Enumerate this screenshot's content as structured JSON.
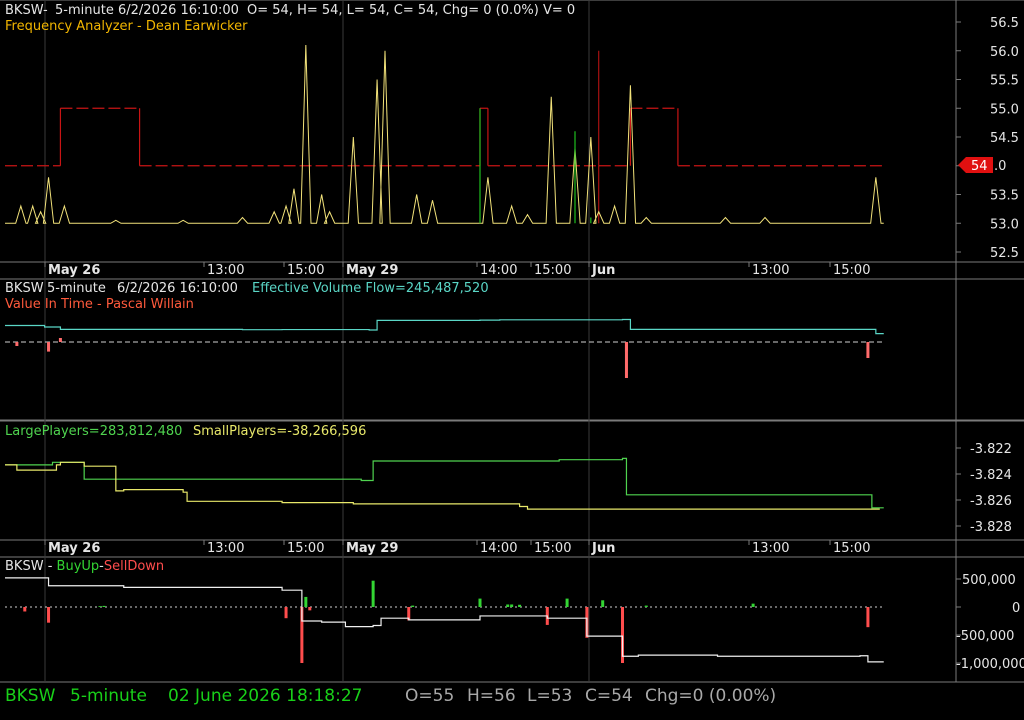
{
  "colors": {
    "background": "#000000",
    "grid": "#3a3a3a",
    "axis_text": "#e6e6e6",
    "price_line": "#f2e27a",
    "price_cross": "#1fbf1f",
    "level_dash": "#c81414",
    "evf_line": "#5ad6c6",
    "viw_bar": "#ff6b6b",
    "large_players": "#4fd34f",
    "small_players": "#e8e86a",
    "buy_up": "#33d633",
    "sell_down": "#ff4d4d",
    "white_line": "#f0f0f0",
    "status_green": "#19d019",
    "status_grey": "#a8a8a8",
    "price_tag": "#e01010"
  },
  "time_axis": {
    "labels": [
      "May 26",
      "13:00",
      "15:00",
      "May 29",
      "14:00",
      "15:00",
      "Jun",
      "13:00",
      "15:00"
    ],
    "bold": [
      "May 26",
      "May 29",
      "Jun"
    ]
  },
  "panels": {
    "price": {
      "header": {
        "symbol": "BKSW-",
        "interval": "5-minute",
        "datetime": "6/2/2026 16:10:00",
        "ohlc": "O= 54, H= 54, L= 54, C= 54, Chg= 0 (0.0%) V= 0"
      },
      "study": {
        "name": "Frequency Analyzer",
        "separator": " - ",
        "author": "Dean Earwicker"
      },
      "axis_ticks": [
        "56.5",
        "56.0",
        "55.5",
        "55.0",
        "54.5",
        "54.0",
        "53.5",
        "53.0",
        "52.5"
      ],
      "last_price_tag": "54"
    },
    "evf": {
      "header": {
        "symbol": "BKSW",
        "interval": "5-minute",
        "datetime": "6/2/2026 16:10:00",
        "study_label": "Effective Volume Flow=245,487,520"
      },
      "study": {
        "name": "Value In Time",
        "separator": " - ",
        "author": "Pascal Willain"
      }
    },
    "players": {
      "large_label": "LargePlayers=283,812,480",
      "small_label": "SmallPlayers=-38,266,596",
      "axis_ticks": [
        "-3.822",
        "-3.824",
        "-3.826",
        "-3.828"
      ]
    },
    "buysell": {
      "header": {
        "symbol": "BKSW",
        "sep1": " - ",
        "buy": "BuyUp",
        "sep2": "-",
        "sell": "SellDown"
      },
      "axis_ticks": [
        "500,000",
        "0",
        "-500,000",
        "-1,000,000"
      ]
    }
  },
  "status_bar": {
    "symbol": "BKSW",
    "interval": "5-minute",
    "datetime": "02 June 2026 18:18:27",
    "open": "O=55",
    "high": "H=56",
    "low": "L=53",
    "close": "C=54",
    "change": "Chg=0 (0.00%)"
  },
  "chart_data": [
    {
      "type": "line",
      "title": "Frequency Analyzer - Dean Earwicker",
      "ylim": [
        52.25,
        56.75
      ],
      "y_ticks": [
        52.5,
        53.0,
        53.5,
        54.0,
        54.5,
        55.0,
        55.5,
        56.0,
        56.5
      ],
      "x_range": [
        0,
        240
      ],
      "series": [
        {
          "name": "price_spikes",
          "baseline": 53.0,
          "spikes": [
            [
              4,
              53.3
            ],
            [
              7,
              53.3
            ],
            [
              9,
              53.2
            ],
            [
              11,
              53.8
            ],
            [
              15,
              53.3
            ],
            [
              28,
              53.05
            ],
            [
              45,
              53.05
            ],
            [
              60,
              53.1
            ],
            [
              68,
              53.2
            ],
            [
              71,
              53.3
            ],
            [
              73,
              53.6
            ],
            [
              76,
              56.1
            ],
            [
              80,
              53.5
            ],
            [
              82,
              53.2
            ],
            [
              88,
              54.5
            ],
            [
              94,
              55.5
            ],
            [
              96,
              56.0
            ],
            [
              104,
              53.5
            ],
            [
              108,
              53.4
            ],
            [
              122,
              53.8
            ],
            [
              128,
              53.3
            ],
            [
              132,
              53.15
            ],
            [
              138,
              55.2
            ],
            [
              144,
              54.3
            ],
            [
              148,
              54.5
            ],
            [
              150,
              53.2
            ],
            [
              154,
              53.3
            ],
            [
              158,
              55.4
            ],
            [
              162,
              53.1
            ],
            [
              182,
              53.1
            ],
            [
              192,
              53.1
            ],
            [
              220,
              53.8
            ]
          ]
        },
        {
          "name": "level_dashes",
          "segments": [
            [
              0,
              14,
              54.0
            ],
            [
              14,
              34,
              55.0
            ],
            [
              34,
              120,
              54.0
            ],
            [
              120,
              122,
              55.0
            ],
            [
              122,
              150,
              54.0
            ],
            [
              150,
              158,
              54.0
            ],
            [
              158,
              170,
              55.0
            ],
            [
              170,
              222,
              54.0
            ]
          ]
        },
        {
          "name": "green_crosses",
          "points": [
            [
              120,
              55.0
            ],
            [
              144,
              54.6
            ],
            [
              148,
              53.1
            ]
          ]
        }
      ]
    },
    {
      "type": "line",
      "title": "Effective Volume Flow",
      "series": [
        {
          "name": "Effective Volume Flow",
          "value": 245487520,
          "steps": [
            [
              0,
              0.55
            ],
            [
              10,
              0.5
            ],
            [
              14,
              0.42
            ],
            [
              40,
              0.42
            ],
            [
              60,
              0.41
            ],
            [
              70,
              0.415
            ],
            [
              92,
              0.4
            ],
            [
              94,
              0.72
            ],
            [
              120,
              0.73
            ],
            [
              125,
              0.74
            ],
            [
              156,
              0.75
            ],
            [
              158,
              0.42
            ],
            [
              216,
              0.42
            ],
            [
              220,
              0.28
            ],
            [
              222,
              0.28
            ]
          ]
        },
        {
          "name": "Value In Time",
          "bars": [
            [
              3,
              -0.05
            ],
            [
              11,
              -0.12
            ],
            [
              14,
              0.05
            ],
            [
              157,
              -0.45
            ],
            [
              157,
              -0.12
            ],
            [
              218,
              -0.2
            ]
          ]
        }
      ]
    },
    {
      "type": "line",
      "ylim": [
        -3.8292,
        -3.8208
      ],
      "y_ticks": [
        -3.822,
        -3.824,
        -3.826,
        -3.828
      ],
      "series": [
        {
          "name": "LargePlayers",
          "value": 283812480,
          "steps": [
            [
              0,
              -3.8233
            ],
            [
              12,
              -3.8231
            ],
            [
              20,
              -3.8244
            ],
            [
              60,
              -3.8244
            ],
            [
              90,
              -3.8245
            ],
            [
              93,
              -3.823
            ],
            [
              140,
              -3.8229
            ],
            [
              156,
              -3.8228
            ],
            [
              157,
              -3.8256
            ],
            [
              217,
              -3.8256
            ],
            [
              219,
              -3.8266
            ],
            [
              222,
              -3.8266
            ]
          ]
        },
        {
          "name": "SmallPlayers",
          "value": -38266596,
          "steps": [
            [
              0,
              -3.8233
            ],
            [
              3,
              -3.8237
            ],
            [
              11,
              -3.8237
            ],
            [
              13,
              -3.8233
            ],
            [
              14,
              -3.8231
            ],
            [
              20,
              -3.8234
            ],
            [
              28,
              -3.8253
            ],
            [
              30,
              -3.8252
            ],
            [
              38,
              -3.8252
            ],
            [
              45,
              -3.8254
            ],
            [
              46,
              -3.8261
            ],
            [
              70,
              -3.8262
            ],
            [
              86,
              -3.8262
            ],
            [
              88,
              -3.8263
            ],
            [
              130,
              -3.8265
            ],
            [
              132,
              -3.8267
            ],
            [
              180,
              -3.8267
            ],
            [
              221,
              -3.8267
            ]
          ]
        }
      ]
    },
    {
      "type": "bar",
      "ylim": [
        -1200000,
        700000
      ],
      "y_ticks": [
        500000,
        0,
        -500000,
        -1000000
      ],
      "series": [
        {
          "name": "BuyUp",
          "bars": [
            [
              24,
              15000
            ],
            [
              25,
              20000
            ],
            [
              76,
              180000
            ],
            [
              93,
              470000
            ],
            [
              103,
              25000
            ],
            [
              120,
              150000
            ],
            [
              127,
              45000
            ],
            [
              128,
              45000
            ],
            [
              130,
              40000
            ],
            [
              142,
              150000
            ],
            [
              151,
              120000
            ],
            [
              162,
              25000
            ],
            [
              189,
              60000
            ]
          ]
        },
        {
          "name": "SellDown",
          "bars": [
            [
              5,
              -80000
            ],
            [
              11,
              -280000
            ],
            [
              71,
              -200000
            ],
            [
              75,
              -1000000
            ],
            [
              77,
              -60000
            ],
            [
              102,
              -240000
            ],
            [
              137,
              -320000
            ],
            [
              147,
              -550000
            ],
            [
              156,
              -1000000
            ],
            [
              218,
              -360000
            ]
          ]
        },
        {
          "name": "cumulative_line",
          "steps": [
            [
              0,
              520000
            ],
            [
              11,
              380000
            ],
            [
              30,
              350000
            ],
            [
              70,
              300000
            ],
            [
              75,
              -250000
            ],
            [
              80,
              -270000
            ],
            [
              86,
              -350000
            ],
            [
              93,
              -330000
            ],
            [
              95,
              -200000
            ],
            [
              102,
              -230000
            ],
            [
              120,
              -160000
            ],
            [
              137,
              -200000
            ],
            [
              147,
              -520000
            ],
            [
              156,
              -880000
            ],
            [
              160,
              -860000
            ],
            [
              180,
              -880000
            ],
            [
              216,
              -870000
            ],
            [
              218,
              -980000
            ],
            [
              222,
              -980000
            ]
          ]
        }
      ]
    }
  ]
}
